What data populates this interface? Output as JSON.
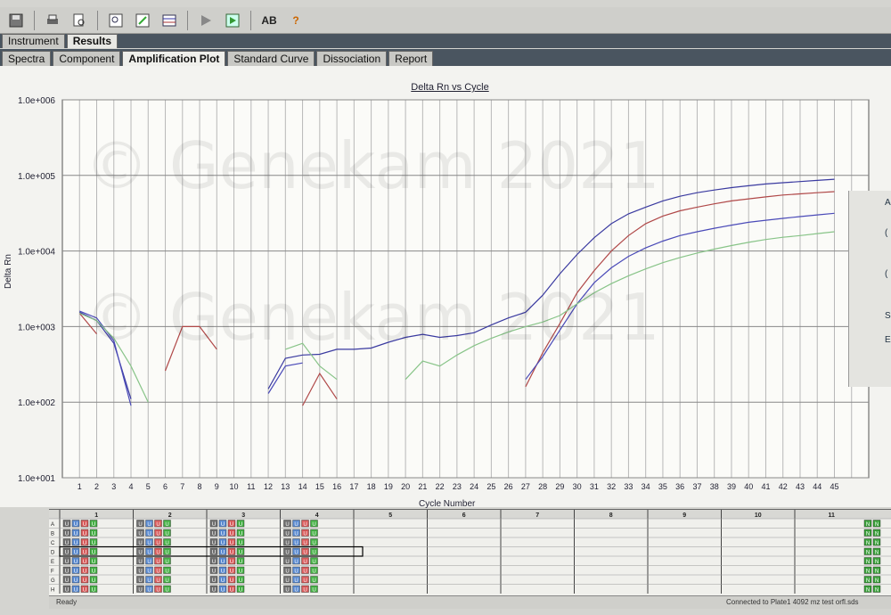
{
  "toolbar": {
    "icons": [
      "save-icon",
      "print-icon",
      "print-preview-icon",
      "find-icon",
      "edit-icon",
      "table-icon",
      "run-icon",
      "export-icon",
      "spelling-icon",
      "help-icon"
    ],
    "ab_label": "AB",
    "help_label": "?"
  },
  "tabs_top": [
    "Instrument",
    "Results"
  ],
  "tabs_sub": [
    "Spectra",
    "Component",
    "Amplification Plot",
    "Standard Curve",
    "Dissociation",
    "Report"
  ],
  "active_top": "Results",
  "active_sub": "Amplification Plot",
  "watermark": "© Genekam 2021",
  "right_panel": {
    "labels": [
      "A",
      "(",
      "(",
      "S",
      "E"
    ]
  },
  "chart_data": {
    "type": "line",
    "title": "Delta Rn vs Cycle",
    "xlabel": "Cycle Number",
    "ylabel": "Delta Rn",
    "yscale": "log",
    "ylim": [
      10,
      1000000
    ],
    "yticks": [
      "1.0e+006",
      "1.0e+005",
      "1.0e+004",
      "1.0e+003",
      "1.0e+002",
      "1.0e+001"
    ],
    "xticks": [
      "1",
      "2",
      "3",
      "4",
      "5",
      "6",
      "7",
      "8",
      "9",
      "10",
      "11",
      "12",
      "13",
      "14",
      "15",
      "16",
      "17",
      "18",
      "19",
      "20",
      "21",
      "22",
      "23",
      "24",
      "25",
      "26",
      "27",
      "28",
      "29",
      "30",
      "31",
      "32",
      "33",
      "34",
      "35",
      "36",
      "37",
      "38",
      "39",
      "40",
      "41",
      "42",
      "43",
      "44",
      "45"
    ],
    "grid": true,
    "series": [
      {
        "color": "#3a3aa0",
        "segments": [
          [
            [
              1,
              1550
            ],
            [
              2,
              1200
            ],
            [
              3,
              600
            ],
            [
              4,
              110
            ]
          ],
          [
            [
              12,
              150
            ],
            [
              13,
              380
            ],
            [
              14,
              420
            ],
            [
              15,
              430
            ],
            [
              16,
              500
            ],
            [
              17,
              500
            ],
            [
              18,
              520
            ],
            [
              19,
              620
            ],
            [
              20,
              720
            ],
            [
              21,
              790
            ],
            [
              22,
              720
            ],
            [
              23,
              760
            ],
            [
              24,
              830
            ],
            [
              25,
              1050
            ],
            [
              26,
              1300
            ],
            [
              27,
              1550
            ],
            [
              28,
              2600
            ],
            [
              29,
              5000
            ],
            [
              30,
              9000
            ],
            [
              31,
              15000
            ],
            [
              32,
              23000
            ],
            [
              33,
              31000
            ],
            [
              34,
              38000
            ],
            [
              35,
              46000
            ],
            [
              36,
              53000
            ],
            [
              37,
              59000
            ],
            [
              38,
              64000
            ],
            [
              39,
              69000
            ],
            [
              40,
              73000
            ],
            [
              41,
              77000
            ],
            [
              42,
              80000
            ],
            [
              43,
              83000
            ],
            [
              44,
              86000
            ],
            [
              45,
              89000
            ]
          ]
        ]
      },
      {
        "color": "#b04848",
        "segments": [
          [
            [
              1,
              1500
            ],
            [
              2,
              800
            ]
          ],
          [
            [
              6,
              260
            ],
            [
              7,
              1000
            ],
            [
              8,
              1000
            ],
            [
              9,
              500
            ]
          ],
          [
            [
              14,
              90
            ],
            [
              15,
              240
            ],
            [
              16,
              110
            ]
          ],
          [
            [
              27,
              160
            ],
            [
              28,
              450
            ],
            [
              29,
              1100
            ],
            [
              30,
              2800
            ],
            [
              31,
              5500
            ],
            [
              32,
              10000
            ],
            [
              33,
              16000
            ],
            [
              34,
              23000
            ],
            [
              35,
              29000
            ],
            [
              36,
              34000
            ],
            [
              37,
              38000
            ],
            [
              38,
              42000
            ],
            [
              39,
              46000
            ],
            [
              40,
              49000
            ],
            [
              41,
              52000
            ],
            [
              42,
              55000
            ],
            [
              43,
              57000
            ],
            [
              44,
              59000
            ],
            [
              45,
              61000
            ]
          ]
        ]
      },
      {
        "color": "#4a4ab8",
        "segments": [
          [
            [
              1,
              1600
            ],
            [
              2,
              1300
            ],
            [
              3,
              650
            ],
            [
              4,
              90
            ]
          ],
          [
            [
              12,
              130
            ],
            [
              13,
              300
            ],
            [
              14,
              330
            ]
          ],
          [
            [
              27,
              200
            ],
            [
              28,
              400
            ],
            [
              29,
              900
            ],
            [
              30,
              2000
            ],
            [
              31,
              3800
            ],
            [
              32,
              6000
            ],
            [
              33,
              8500
            ],
            [
              34,
              11000
            ],
            [
              35,
              13500
            ],
            [
              36,
              16000
            ],
            [
              37,
              18000
            ],
            [
              38,
              20000
            ],
            [
              39,
              22000
            ],
            [
              40,
              24000
            ],
            [
              41,
              25500
            ],
            [
              42,
              27000
            ],
            [
              43,
              28500
            ],
            [
              44,
              30000
            ],
            [
              45,
              31500
            ]
          ]
        ]
      },
      {
        "color": "#88c488",
        "segments": [
          [
            [
              1,
              1500
            ],
            [
              2,
              1200
            ],
            [
              3,
              700
            ],
            [
              4,
              300
            ],
            [
              5,
              100
            ]
          ],
          [
            [
              13,
              500
            ],
            [
              14,
              600
            ],
            [
              15,
              300
            ],
            [
              16,
              200
            ]
          ],
          [
            [
              20,
              200
            ],
            [
              21,
              350
            ],
            [
              22,
              300
            ],
            [
              23,
              420
            ],
            [
              24,
              560
            ],
            [
              25,
              700
            ],
            [
              26,
              850
            ],
            [
              27,
              1000
            ],
            [
              28,
              1150
            ],
            [
              29,
              1400
            ],
            [
              30,
              2000
            ],
            [
              31,
              2800
            ],
            [
              32,
              3700
            ],
            [
              33,
              4700
            ],
            [
              34,
              5800
            ],
            [
              35,
              7000
            ],
            [
              36,
              8200
            ],
            [
              37,
              9400
            ],
            [
              38,
              10600
            ],
            [
              39,
              11800
            ],
            [
              40,
              13000
            ],
            [
              41,
              14200
            ],
            [
              42,
              15200
            ],
            [
              43,
              16000
            ],
            [
              44,
              17000
            ],
            [
              45,
              18000
            ]
          ]
        ]
      }
    ]
  },
  "plate": {
    "columns": [
      "1",
      "2",
      "3",
      "4",
      "5",
      "6",
      "7",
      "8",
      "9",
      "10",
      "11"
    ],
    "rows": [
      "A",
      "B",
      "C",
      "D",
      "E",
      "F",
      "G",
      "H"
    ],
    "well_letters": [
      "U",
      "U",
      "U",
      "U"
    ],
    "right_labels": [
      "N",
      "N"
    ]
  },
  "status": {
    "left": "Ready",
    "right": "Connected to Plate1 4092 mz test orfl.sds"
  }
}
